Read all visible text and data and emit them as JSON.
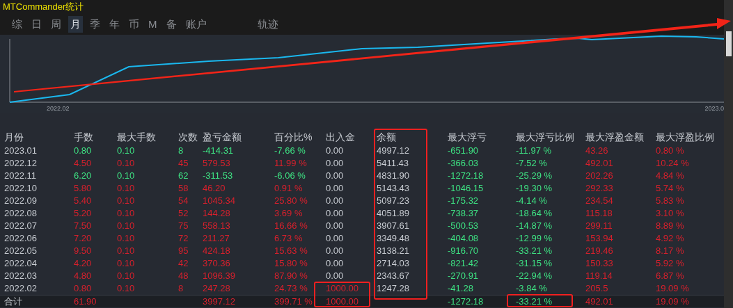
{
  "window": {
    "title": "MTCommander统计"
  },
  "tabs": [
    {
      "label": "综",
      "selected": false
    },
    {
      "label": "日",
      "selected": false
    },
    {
      "label": "周",
      "selected": false
    },
    {
      "label": "月",
      "selected": true
    },
    {
      "label": "季",
      "selected": false
    },
    {
      "label": "年",
      "selected": false
    },
    {
      "label": "币",
      "selected": false
    },
    {
      "label": "M",
      "selected": false
    },
    {
      "label": "备",
      "selected": false
    },
    {
      "label": "账户",
      "selected": false
    }
  ],
  "trail_tab": {
    "label": "轨迹",
    "selected": false
  },
  "chart": {
    "x_labels": [
      "2022.02",
      "2023.0"
    ]
  },
  "table": {
    "columns": [
      "月份",
      "手数",
      "最大手数",
      "次数",
      "盈亏金额",
      "百分比%",
      "出入金",
      "余额",
      "最大浮亏",
      "最大浮亏比例",
      "最大浮盈金额",
      "最大浮盈比例"
    ],
    "rows": [
      {
        "cells": [
          "2023.01",
          "0.80",
          "0.10",
          "8",
          "-414.31",
          "-7.66 %",
          "0.00",
          "4997.12",
          "-651.90",
          "-11.97 %",
          "43.26",
          "0.80 %"
        ],
        "loss": true,
        "deposit": false
      },
      {
        "cells": [
          "2022.12",
          "4.50",
          "0.10",
          "45",
          "579.53",
          "11.99 %",
          "0.00",
          "5411.43",
          "-366.03",
          "-7.52 %",
          "492.01",
          "10.24 %"
        ],
        "loss": false,
        "deposit": false
      },
      {
        "cells": [
          "2022.11",
          "6.20",
          "0.10",
          "62",
          "-311.53",
          "-6.06 %",
          "0.00",
          "4831.90",
          "-1272.18",
          "-25.29 %",
          "202.26",
          "4.84 %"
        ],
        "loss": true,
        "deposit": false
      },
      {
        "cells": [
          "2022.10",
          "5.80",
          "0.10",
          "58",
          "46.20",
          "0.91 %",
          "0.00",
          "5143.43",
          "-1046.15",
          "-19.30 %",
          "292.33",
          "5.74 %"
        ],
        "loss": false,
        "deposit": false
      },
      {
        "cells": [
          "2022.09",
          "5.40",
          "0.10",
          "54",
          "1045.34",
          "25.80 %",
          "0.00",
          "5097.23",
          "-175.32",
          "-4.14 %",
          "234.54",
          "5.83 %"
        ],
        "loss": false,
        "deposit": false
      },
      {
        "cells": [
          "2022.08",
          "5.20",
          "0.10",
          "52",
          "144.28",
          "3.69 %",
          "0.00",
          "4051.89",
          "-738.37",
          "-18.64 %",
          "115.18",
          "3.10 %"
        ],
        "loss": false,
        "deposit": false
      },
      {
        "cells": [
          "2022.07",
          "7.50",
          "0.10",
          "75",
          "558.13",
          "16.66 %",
          "0.00",
          "3907.61",
          "-500.53",
          "-14.87 %",
          "299.11",
          "8.89 %"
        ],
        "loss": false,
        "deposit": false
      },
      {
        "cells": [
          "2022.06",
          "7.20",
          "0.10",
          "72",
          "211.27",
          "6.73 %",
          "0.00",
          "3349.48",
          "-404.08",
          "-12.99 %",
          "153.94",
          "4.92 %"
        ],
        "loss": false,
        "deposit": false
      },
      {
        "cells": [
          "2022.05",
          "9.50",
          "0.10",
          "95",
          "424.18",
          "15.63 %",
          "0.00",
          "3138.21",
          "-916.70",
          "-33.21 %",
          "219.46",
          "8.17 %"
        ],
        "loss": false,
        "deposit": false
      },
      {
        "cells": [
          "2022.04",
          "4.20",
          "0.10",
          "42",
          "370.36",
          "15.80 %",
          "0.00",
          "2714.03",
          "-821.42",
          "-31.15 %",
          "150.33",
          "5.92 %"
        ],
        "loss": false,
        "deposit": false
      },
      {
        "cells": [
          "2022.03",
          "4.80",
          "0.10",
          "48",
          "1096.39",
          "87.90 %",
          "0.00",
          "2343.67",
          "-270.91",
          "-22.94 %",
          "119.14",
          "6.87 %"
        ],
        "loss": false,
        "deposit": false
      },
      {
        "cells": [
          "2022.02",
          "0.80",
          "0.10",
          "8",
          "247.28",
          "24.73 %",
          "1000.00",
          "1247.28",
          "-41.28",
          "-3.84 %",
          "205.5",
          "19.09 %"
        ],
        "loss": false,
        "deposit": true
      }
    ],
    "total": {
      "cells": [
        "合计",
        "61.90",
        "",
        "",
        "3997.12",
        "399.71 %",
        "1000.00",
        "",
        "-1272.18",
        "-33.21 %",
        "492.01",
        "19.09 %"
      ]
    }
  }
}
